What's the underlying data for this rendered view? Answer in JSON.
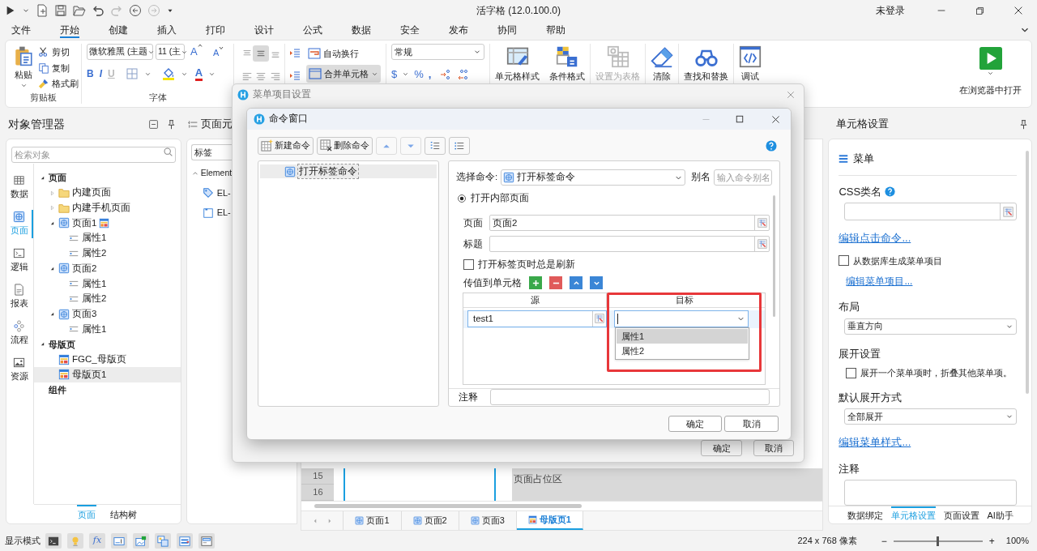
{
  "title_bar": {
    "title": "活字格 (12.0.100.0)",
    "account": "未登录"
  },
  "menu_tabs": [
    {
      "label": "文件",
      "selected": false
    },
    {
      "label": "开始",
      "selected": true
    },
    {
      "label": "创建",
      "selected": false
    },
    {
      "label": "插入",
      "selected": false
    },
    {
      "label": "打印",
      "selected": false
    },
    {
      "label": "设计",
      "selected": false
    },
    {
      "label": "公式",
      "selected": false
    },
    {
      "label": "数据",
      "selected": false
    },
    {
      "label": "安全",
      "selected": false
    },
    {
      "label": "发布",
      "selected": false
    },
    {
      "label": "协同",
      "selected": false
    },
    {
      "label": "帮助",
      "selected": false
    }
  ],
  "ribbon": {
    "clipboard": {
      "paste": "粘贴",
      "cut": "剪切",
      "copy": "复制",
      "format_painter": "格式刷",
      "group_label": "剪贴板"
    },
    "font": {
      "family": "微软雅黑 (主题",
      "size": "11 (主",
      "grow": "A",
      "shrink": "A",
      "bold": "B",
      "italic": "I",
      "underline": "U",
      "font_color": "A",
      "group_label": "字体"
    },
    "alignment": {
      "align_buttons": [
        {
          "selected": false
        },
        {
          "selected": true
        },
        {
          "selected": false
        },
        {
          "selected": false
        },
        {
          "selected": false
        },
        {
          "selected": false
        }
      ],
      "wrap_text": "自动换行",
      "merge": {
        "label": "合并单元格",
        "on": true
      }
    },
    "number": {
      "format": "常规",
      "currency": "$",
      "percent": "%",
      "comma": ","
    },
    "large_buttons": [
      {
        "label": "单元格样式",
        "kind": "cell-style",
        "disabled": false
      },
      {
        "label": "条件格式",
        "kind": "conditional",
        "disabled": false
      },
      {
        "label": "设置为表格",
        "kind": "table",
        "disabled": true
      },
      {
        "label": "清除",
        "kind": "eraser",
        "disabled": false
      },
      {
        "label": "查找和替换",
        "kind": "find",
        "disabled": false
      },
      {
        "label": "调试",
        "kind": "debug",
        "disabled": false
      }
    ],
    "run": {
      "label": "在浏览器中打开"
    }
  },
  "object_manager": {
    "title": "对象管理器",
    "search_placeholder": "检索对象",
    "rail": [
      {
        "label": "数据",
        "kind": "data",
        "selected": false
      },
      {
        "label": "页面",
        "kind": "page",
        "selected": true
      },
      {
        "label": "逻辑",
        "kind": "logic",
        "selected": false
      },
      {
        "label": "报表",
        "kind": "report",
        "selected": false
      },
      {
        "label": "流程",
        "kind": "flow",
        "selected": false
      },
      {
        "label": "资源",
        "kind": "resource",
        "selected": false
      }
    ],
    "tree": [
      {
        "label": "页面",
        "kind": "group",
        "expanded": true,
        "selected": false,
        "children": [
          {
            "label": "内建页面",
            "kind": "folder",
            "expanded": false,
            "selected": false
          },
          {
            "label": "内建手机页面",
            "kind": "folder",
            "expanded": false,
            "selected": false
          },
          {
            "label": "页面1",
            "kind": "page",
            "expanded": true,
            "selected": false,
            "badge": true,
            "children": [
              {
                "label": "属性1",
                "kind": "attr",
                "selected": false
              },
              {
                "label": "属性2",
                "kind": "attr",
                "selected": false
              }
            ]
          },
          {
            "label": "页面2",
            "kind": "page",
            "expanded": true,
            "selected": false,
            "badge": false,
            "children": [
              {
                "label": "属性1",
                "kind": "attr",
                "selected": false
              },
              {
                "label": "属性2",
                "kind": "attr",
                "selected": false
              }
            ]
          },
          {
            "label": "页面3",
            "kind": "page",
            "expanded": true,
            "selected": false,
            "badge": false,
            "children": [
              {
                "label": "属性1",
                "kind": "attr",
                "selected": false
              }
            ]
          }
        ]
      },
      {
        "label": "母版页",
        "kind": "group",
        "expanded": true,
        "selected": false,
        "children": [
          {
            "label": "FGC_母版页",
            "kind": "master",
            "selected": false
          },
          {
            "label": "母版页1",
            "kind": "master",
            "selected": true
          }
        ]
      },
      {
        "label": "组件",
        "kind": "group",
        "selected": false
      }
    ],
    "tabs": [
      {
        "label": "页面",
        "selected": true
      },
      {
        "label": "结构树",
        "selected": false
      }
    ]
  },
  "page_elements": {
    "title": "页面元",
    "filter": "标签",
    "section": "Element",
    "items": [
      {
        "label": "EL-",
        "kind": "tag"
      },
      {
        "label": "EL-",
        "kind": "frame"
      }
    ]
  },
  "canvas": {
    "row_numbers": [
      "15",
      "16"
    ],
    "placeholder_area": "页面占位区",
    "sheet_tabs": [
      {
        "label": "页面1",
        "kind": "page",
        "selected": false
      },
      {
        "label": "页面2",
        "kind": "page",
        "selected": false
      },
      {
        "label": "页面3",
        "kind": "page",
        "selected": false
      },
      {
        "label": "母版页1",
        "kind": "master",
        "selected": true
      }
    ]
  },
  "cell_settings": {
    "title": "单元格设置",
    "cell_type": "菜单",
    "css_label": "CSS类名",
    "edit_command_link": "编辑点击命令...",
    "from_db": {
      "label": "从数据库生成菜单项目",
      "checked": false
    },
    "edit_items_link": "编辑菜单项目...",
    "layout_label": "布局",
    "layout_value": "垂直方向",
    "expand_label": "展开设置",
    "collapse_others": {
      "label": "展开一个菜单项时，折叠其他菜单项。",
      "checked": false
    },
    "default_expand_label": "默认展开方式",
    "default_expand_value": "全部展开",
    "edit_style_link": "编辑菜单样式...",
    "note_label": "注释",
    "tabs": [
      {
        "label": "数据绑定",
        "selected": false
      },
      {
        "label": "单元格设置",
        "selected": true
      },
      {
        "label": "页面设置",
        "selected": false
      },
      {
        "label": "AI助手",
        "selected": false
      }
    ]
  },
  "status_bar": {
    "mode_label": "显示模式",
    "tools": [
      {
        "kind": "terminal"
      },
      {
        "kind": "bulb"
      },
      {
        "kind": "formula",
        "label": "fx"
      },
      {
        "kind": "textbox"
      },
      {
        "kind": "picture-frame"
      },
      {
        "kind": "layers"
      },
      {
        "kind": "menu"
      },
      {
        "kind": "form"
      }
    ],
    "size": "224 x 768 像素",
    "zoom_out": "−",
    "zoom_in": "+",
    "zoom": {
      "level": 0.5
    },
    "zoom_value": "100%"
  },
  "menu_item_dialog": {
    "title": "菜单项目设置",
    "ok": "确定",
    "cancel": "取消"
  },
  "command_dialog": {
    "title": "命令窗口",
    "new_command": "新建命令",
    "delete_command": "删除命令",
    "commands": [
      {
        "label": "打开标签命令",
        "selected": true
      }
    ],
    "select_label": "选择命令:",
    "command": "打开标签命令",
    "alias_label": "别名",
    "alias_placeholder": "输入命令别名",
    "mode": {
      "label": "打开内部页面",
      "checked": true
    },
    "page_label": "页面",
    "page_value": "页面2",
    "caption_label": "标题",
    "refresh": {
      "label": "打开标签页时总是刷新",
      "checked": false
    },
    "pass_label": "传值到单元格",
    "columns": [
      "源",
      "目标"
    ],
    "rows": [
      {
        "source": "test1"
      }
    ],
    "target_options": [
      {
        "label": "属性1",
        "selected": true
      },
      {
        "label": "属性2",
        "selected": false
      }
    ],
    "note_label": "注释",
    "ok": "确定",
    "cancel": "取消"
  }
}
